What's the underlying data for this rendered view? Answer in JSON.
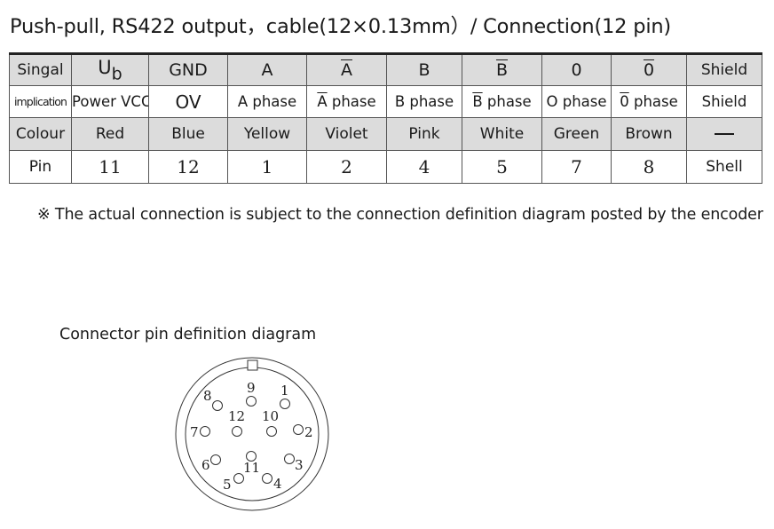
{
  "title": "Push-pull, RS422 output，cable(12×0.13mm）/ Connection(12 pin)",
  "table": {
    "row_labels": {
      "signal": "Singal",
      "implication": "implication",
      "colour": "Colour",
      "pin": "Pin"
    },
    "columns": [
      {
        "signal_main": "U",
        "signal_sub": "b",
        "implication": "Power VCC",
        "colour": "Red",
        "pin": "11"
      },
      {
        "signal_main": "GND",
        "implication": "OV",
        "colour": "Blue",
        "pin": "12"
      },
      {
        "signal_main": "A",
        "implication": "A phase",
        "colour": "Yellow",
        "pin": "1"
      },
      {
        "signal_main": "A",
        "signal_overline": true,
        "implication_prefix": "A",
        "implication": "phase",
        "colour": "Violet",
        "pin": "2"
      },
      {
        "signal_main": "B",
        "implication": "B phase",
        "colour": "Pink",
        "pin": "4"
      },
      {
        "signal_main": "B",
        "signal_overline": true,
        "implication_prefix": "B",
        "implication": "phase",
        "colour": "White",
        "pin": "5"
      },
      {
        "signal_main": "0",
        "implication": "O phase",
        "colour": "Green",
        "pin": "7"
      },
      {
        "signal_main": "0",
        "signal_overline": true,
        "implication_prefix": "0",
        "implication": "phase",
        "colour": "Brown",
        "pin": "8"
      },
      {
        "signal_main": "Shield",
        "implication": "Shield",
        "colour": "—",
        "pin": "Shell"
      }
    ]
  },
  "note": "※ The actual connection is subject to the connection definition diagram posted by the encoder",
  "diagram": {
    "title": "Connector pin definition diagram",
    "pins": [
      "1",
      "2",
      "3",
      "4",
      "5",
      "6",
      "7",
      "8",
      "9",
      "10",
      "11",
      "12"
    ]
  }
}
